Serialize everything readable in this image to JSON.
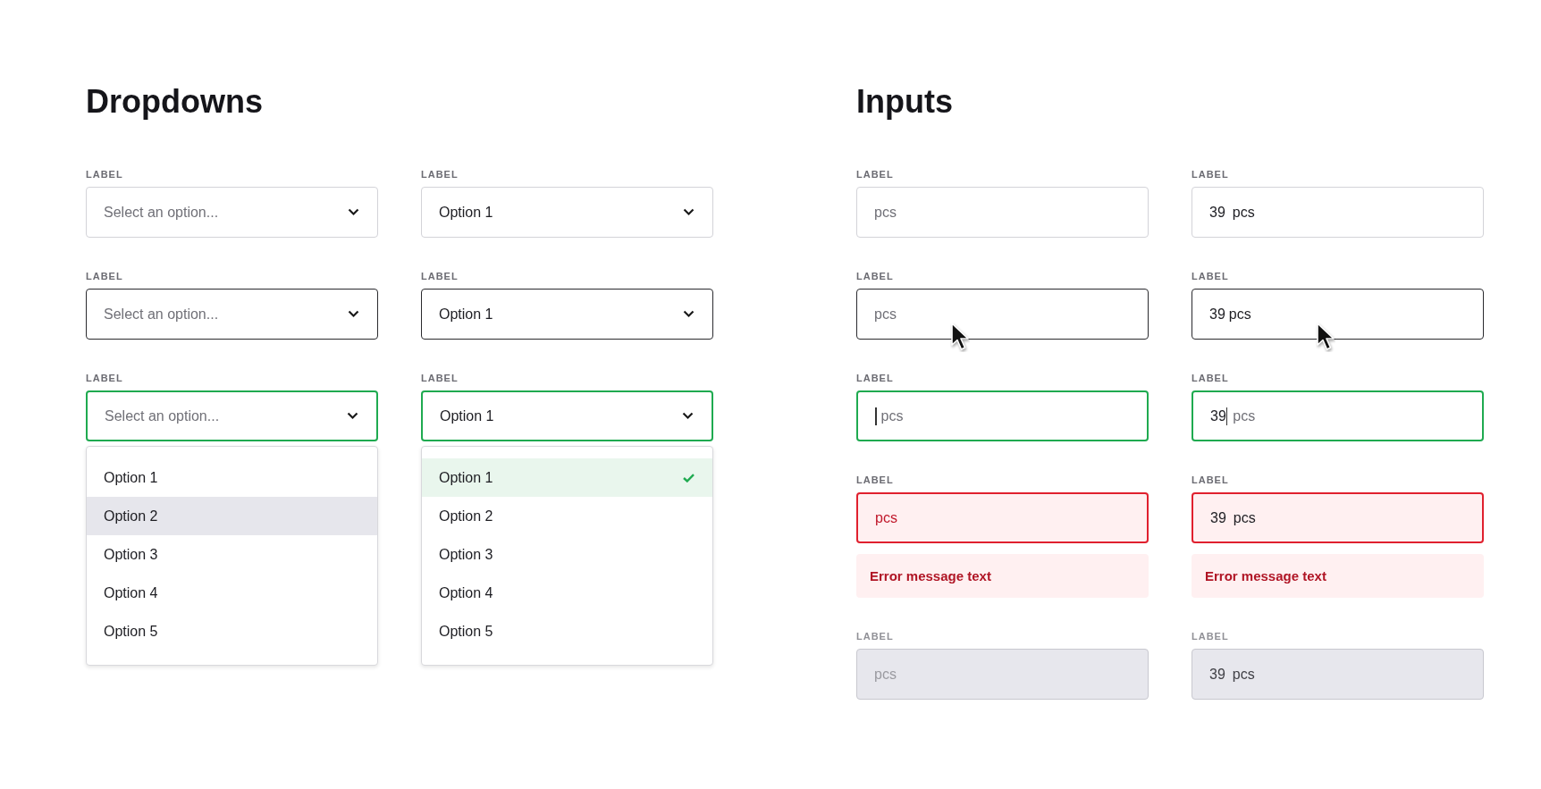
{
  "dropdowns": {
    "title": "Dropdowns",
    "columns": [
      [
        {
          "label": "LABEL",
          "hovered": false,
          "focused": false,
          "placeholder": "Select an option..."
        },
        {
          "label": "LABEL",
          "hovered": true,
          "focused": false,
          "placeholder": "Select an option..."
        },
        {
          "label": "LABEL",
          "hovered": false,
          "focused": true,
          "placeholder": "Select an option...",
          "options": [
            {
              "label": "Option 1",
              "selected": false,
              "hovered": false
            },
            {
              "label": "Option 2",
              "selected": false,
              "hovered": true
            },
            {
              "label": "Option 3",
              "selected": false,
              "hovered": false
            },
            {
              "label": "Option 4",
              "selected": false,
              "hovered": false
            },
            {
              "label": "Option 5",
              "selected": false,
              "hovered": false
            }
          ]
        }
      ],
      [
        {
          "label": "LABEL",
          "hovered": false,
          "focused": false,
          "value": "Option 1"
        },
        {
          "label": "LABEL",
          "hovered": true,
          "focused": false,
          "value": "Option 1"
        },
        {
          "label": "LABEL",
          "hovered": false,
          "focused": true,
          "value": "Option 1",
          "options": [
            {
              "label": "Option 1",
              "selected": true
            },
            {
              "label": "Option 2",
              "selected": false
            },
            {
              "label": "Option 3",
              "selected": false
            },
            {
              "label": "Option 4",
              "selected": false
            },
            {
              "label": "Option 5",
              "selected": false
            }
          ]
        }
      ]
    ]
  },
  "inputs": {
    "title": "Inputs",
    "columns": [
      [
        {
          "label": "LABEL",
          "hovered": false,
          "focused": false,
          "invalid": false,
          "disabled": false,
          "placeholder": "pcs"
        },
        {
          "label": "LABEL",
          "hovered": true,
          "focused": false,
          "invalid": false,
          "disabled": false,
          "placeholder": "pcs",
          "pointer_cursor": true
        },
        {
          "label": "LABEL",
          "hovered": false,
          "focused": true,
          "invalid": false,
          "disabled": false,
          "placeholder": "pcs"
        },
        {
          "label": "LABEL",
          "hovered": false,
          "focused": false,
          "invalid": true,
          "disabled": false,
          "placeholder": "pcs",
          "error": "Error message text"
        },
        {
          "label": "LABEL",
          "hovered": false,
          "focused": false,
          "invalid": false,
          "disabled": true,
          "placeholder": "pcs"
        }
      ],
      [
        {
          "label": "LABEL",
          "hovered": false,
          "focused": false,
          "invalid": false,
          "disabled": false,
          "value": "39",
          "unit": "pcs"
        },
        {
          "label": "LABEL",
          "hovered": true,
          "focused": false,
          "invalid": false,
          "disabled": false,
          "value": "39",
          "unit": "pcs",
          "pointer_cursor": true
        },
        {
          "label": "LABEL",
          "hovered": false,
          "focused": true,
          "invalid": false,
          "disabled": false,
          "value": "39",
          "unit": "pcs"
        },
        {
          "label": "LABEL",
          "hovered": false,
          "focused": false,
          "invalid": true,
          "disabled": false,
          "value": "39",
          "unit": "pcs",
          "error": "Error message text"
        },
        {
          "label": "LABEL",
          "hovered": false,
          "focused": false,
          "invalid": false,
          "disabled": true,
          "value": "39",
          "unit": "pcs"
        }
      ]
    ]
  }
}
